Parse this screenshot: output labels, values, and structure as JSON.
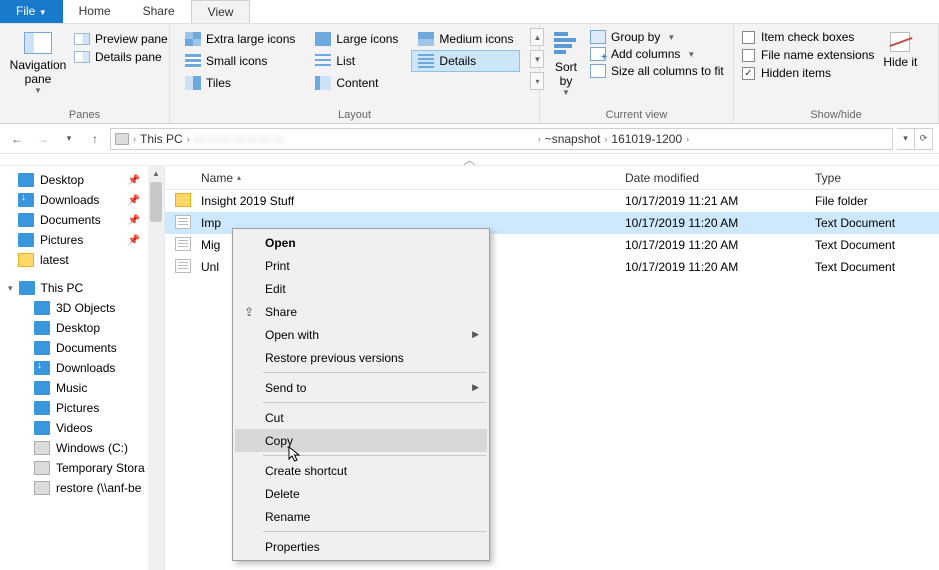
{
  "ribbon": {
    "tabs": {
      "file": "File",
      "home": "Home",
      "share": "Share",
      "view": "View"
    },
    "panes": {
      "label": "Panes",
      "nav": "Navigation pane",
      "preview": "Preview pane",
      "details": "Details pane"
    },
    "layout": {
      "label": "Layout",
      "xl": "Extra large icons",
      "lg": "Large icons",
      "md": "Medium icons",
      "sm": "Small icons",
      "list": "List",
      "details": "Details",
      "tiles": "Tiles",
      "content": "Content"
    },
    "current_view": {
      "label": "Current view",
      "sort": "Sort by",
      "group": "Group by",
      "add_cols": "Add columns",
      "fit": "Size all columns to fit"
    },
    "show_hide": {
      "label": "Show/hide",
      "item_cb": "Item check boxes",
      "ext": "File name extensions",
      "hidden": "Hidden items",
      "hide_btn": "Hide it"
    }
  },
  "nav": {
    "breadcrumb": {
      "this_pc": "This PC",
      "obscured": "———————",
      "snapshot": "~snapshot",
      "ts": "161019-1200"
    }
  },
  "tree": {
    "desktop": "Desktop",
    "downloads": "Downloads",
    "documents": "Documents",
    "pictures": "Pictures",
    "latest": "latest",
    "this_pc": "This PC",
    "obj3d": "3D Objects",
    "desktop2": "Desktop",
    "documents2": "Documents",
    "downloads2": "Downloads",
    "music": "Music",
    "pictures2": "Pictures",
    "videos": "Videos",
    "cdrive": "Windows (C:)",
    "temp": "Temporary Stora",
    "restore": "restore (\\\\anf-be"
  },
  "columns": {
    "name": "Name",
    "date": "Date modified",
    "type": "Type"
  },
  "files": [
    {
      "name": "Insight 2019 Stuff",
      "date": "10/17/2019 11:21 AM",
      "type": "File folder",
      "kind": "folder"
    },
    {
      "name": "Imp",
      "date": "10/17/2019 11:20 AM",
      "type": "Text Document",
      "kind": "txt"
    },
    {
      "name": "Mig",
      "date": "10/17/2019 11:20 AM",
      "type": "Text Document",
      "kind": "txt"
    },
    {
      "name": "Unl",
      "date": "10/17/2019 11:20 AM",
      "type": "Text Document",
      "kind": "txt"
    }
  ],
  "ctx": {
    "open": "Open",
    "print": "Print",
    "edit": "Edit",
    "share": "Share",
    "open_with": "Open with",
    "restore": "Restore previous versions",
    "send_to": "Send to",
    "cut": "Cut",
    "copy": "Copy",
    "shortcut": "Create shortcut",
    "delete": "Delete",
    "rename": "Rename",
    "properties": "Properties"
  }
}
